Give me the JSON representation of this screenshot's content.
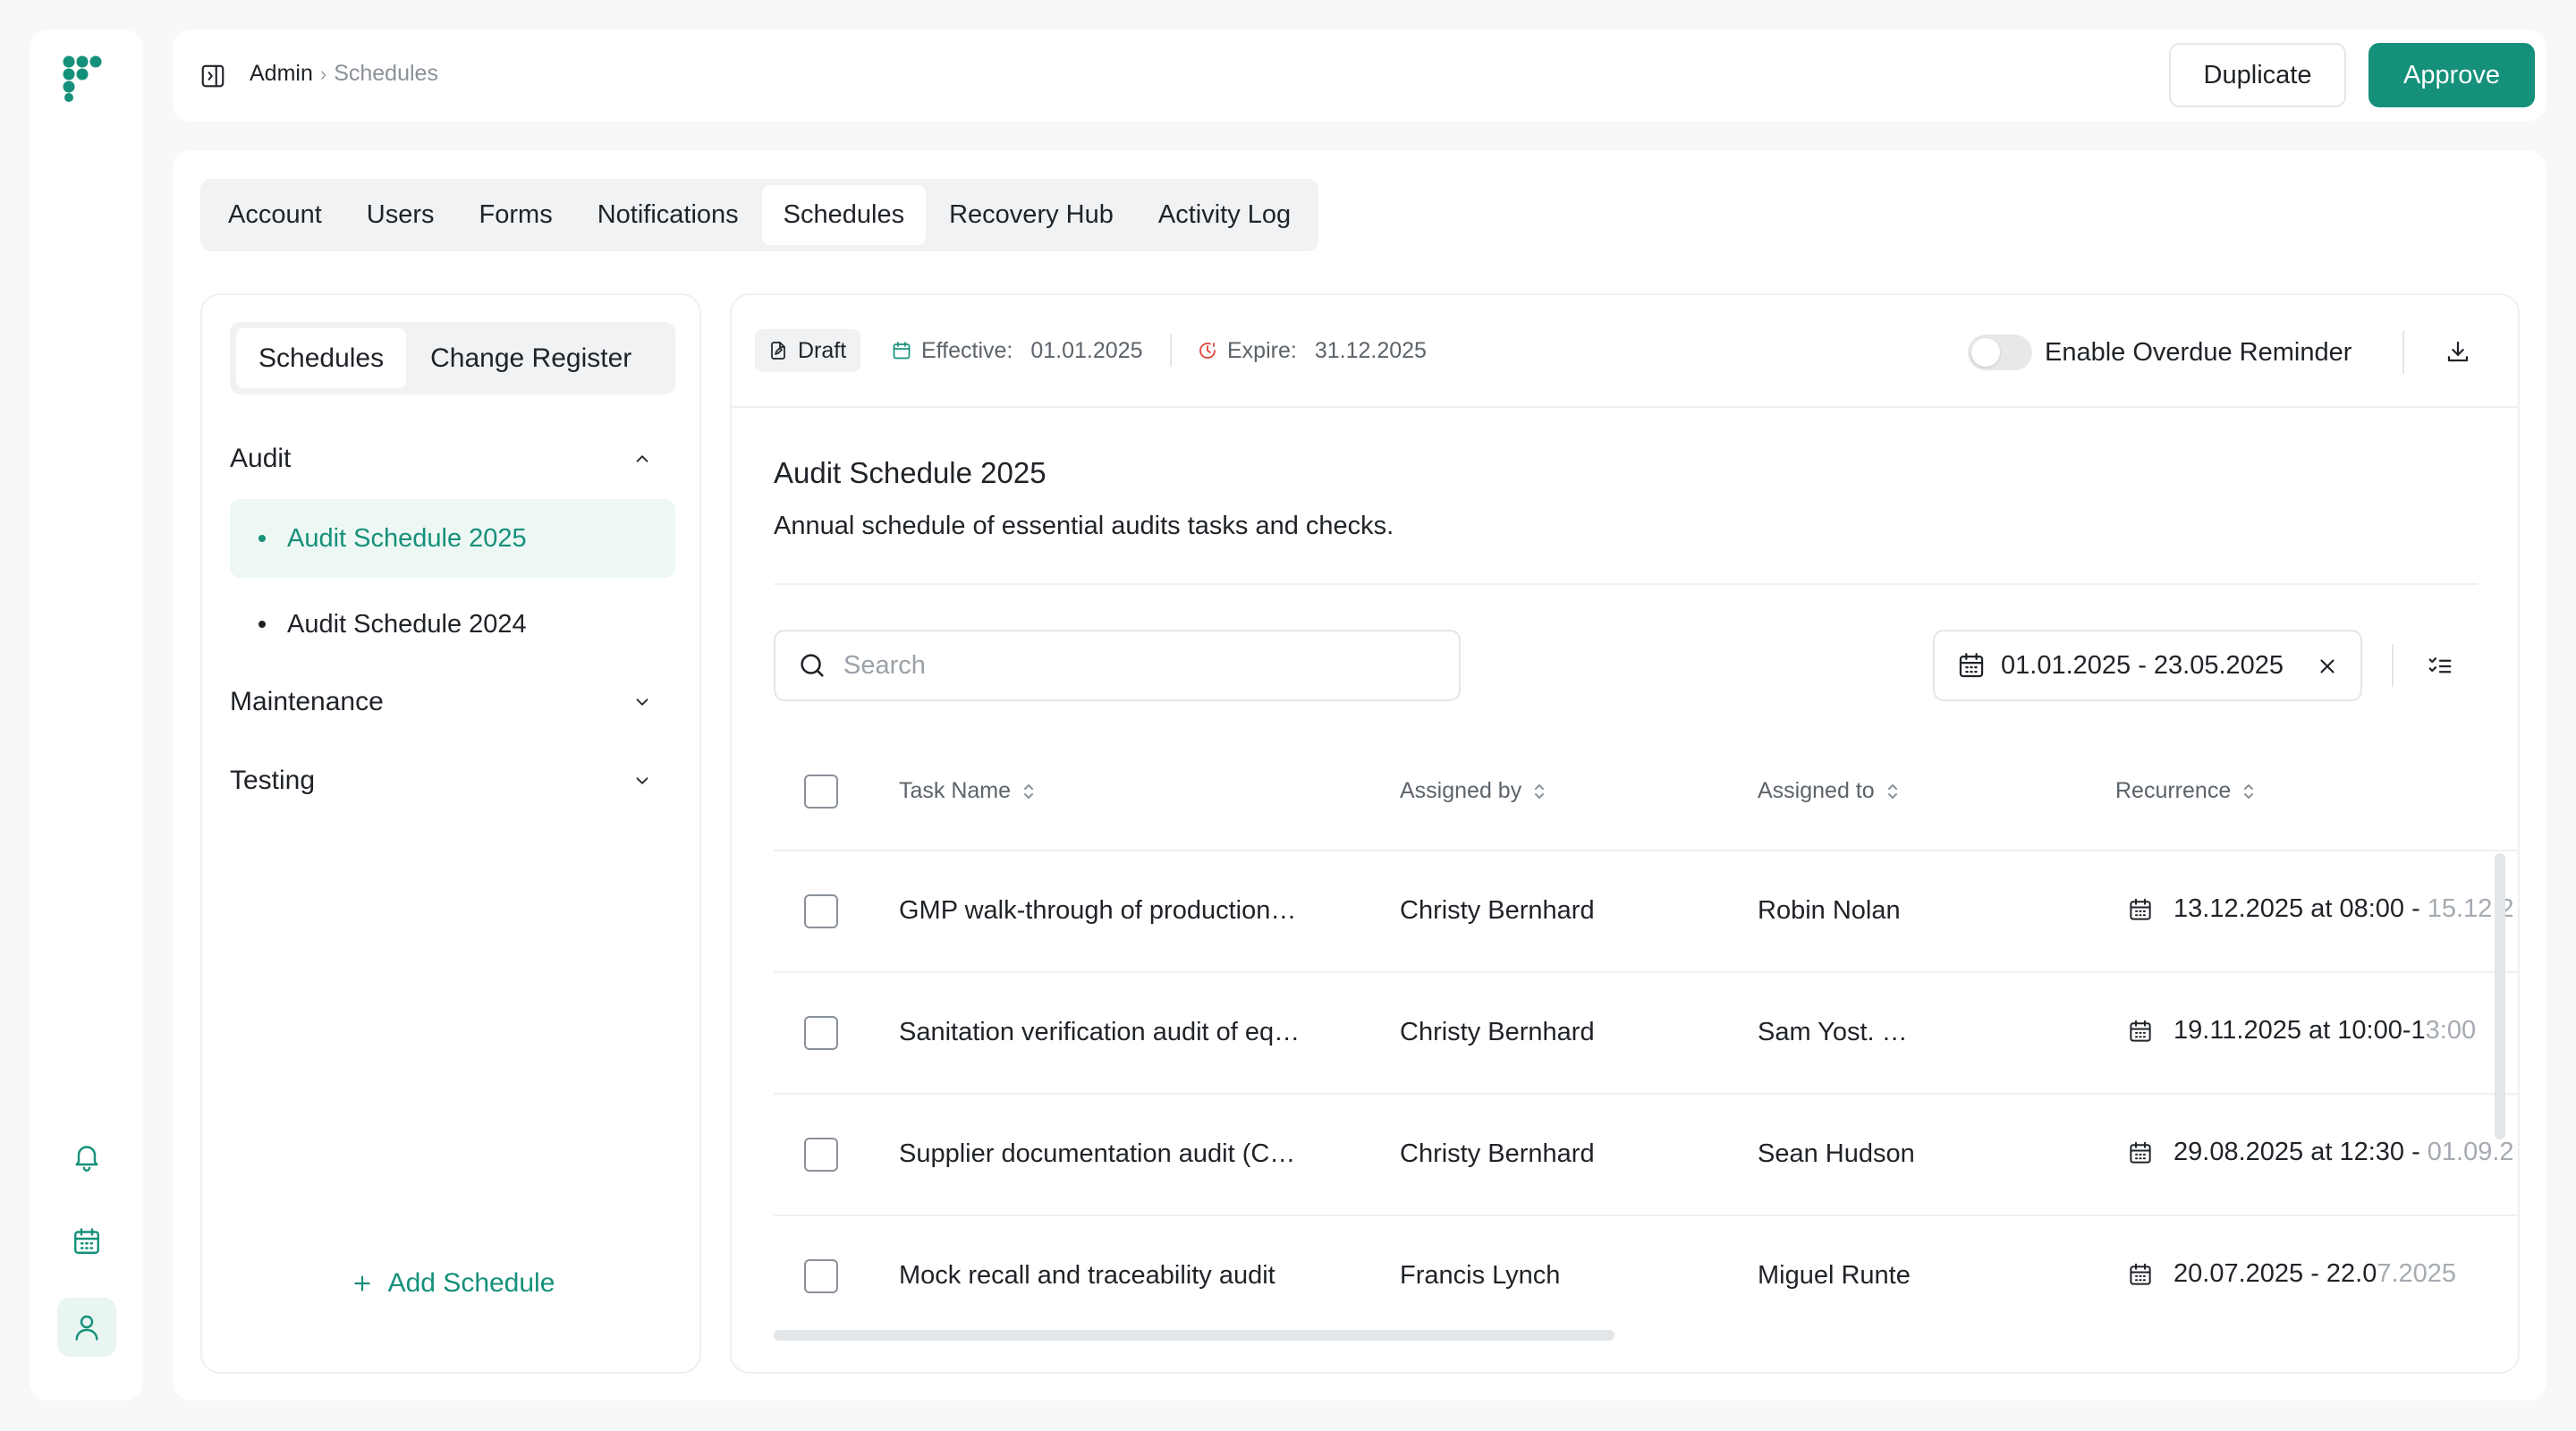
{
  "header": {
    "breadcrumb": {
      "parent": "Admin",
      "separator": "›",
      "current": "Schedules"
    },
    "duplicate_label": "Duplicate",
    "approve_label": "Approve"
  },
  "rail": {
    "items": [
      "bell-icon",
      "calendar-icon",
      "user-icon"
    ],
    "active": "user-icon"
  },
  "tabs": [
    {
      "label": "Account"
    },
    {
      "label": "Users"
    },
    {
      "label": "Forms"
    },
    {
      "label": "Notifications"
    },
    {
      "label": "Schedules",
      "active": true
    },
    {
      "label": "Recovery Hub"
    },
    {
      "label": "Activity Log"
    }
  ],
  "sidebar": {
    "segments": [
      {
        "label": "Schedules",
        "active": true
      },
      {
        "label": "Change Register"
      }
    ],
    "groups": [
      {
        "label": "Audit",
        "expanded": true,
        "items": [
          {
            "label": "Audit Schedule 2025",
            "active": true
          },
          {
            "label": "Audit Schedule 2024"
          }
        ]
      },
      {
        "label": "Maintenance",
        "expanded": false
      },
      {
        "label": "Testing",
        "expanded": false
      }
    ],
    "add_label": "Add Schedule"
  },
  "meta": {
    "status": "Draft",
    "effective_label": "Effective:",
    "effective_value": "01.01.2025",
    "expire_label": "Expire:",
    "expire_value": "31.12.2025",
    "reminder_label": "Enable Overdue Reminder",
    "reminder_enabled": false
  },
  "schedule": {
    "title": "Audit Schedule 2025",
    "description": "Annual schedule of essential audits tasks and checks."
  },
  "filters": {
    "search_placeholder": "Search",
    "date_range": "01.01.2025 - 23.05.2025"
  },
  "table": {
    "columns": [
      "Task Name",
      "Assigned by",
      "Assigned to",
      "Recurrence"
    ],
    "rows": [
      {
        "task": "GMP walk-through of production…",
        "by": "Christy Bernhard",
        "to": "Robin Nolan",
        "recurrence": "13.12.2025 at 08:00 - ",
        "recurrence_fade": "15.12.2"
      },
      {
        "task": "Sanitation verification audit of eq…",
        "by": "Christy Bernhard",
        "to": "Sam Yost. …",
        "recurrence": "19.11.2025 at 10:00-1",
        "recurrence_fade": "3:00"
      },
      {
        "task": "Supplier documentation audit (C…",
        "by": "Christy Bernhard",
        "to": "Sean Hudson",
        "recurrence": "29.08.2025 at 12:30 - ",
        "recurrence_fade": "01.09.2"
      },
      {
        "task": "Mock recall and traceability audit",
        "by": "Francis Lynch",
        "to": "Miguel Runte",
        "recurrence": "20.07.2025 - 22.0",
        "recurrence_fade": "7.2025"
      }
    ]
  },
  "colors": {
    "accent": "#15907a",
    "accent_bg": "#edf8f4",
    "border": "#eef0f1",
    "expire_icon": "#e0413a"
  }
}
